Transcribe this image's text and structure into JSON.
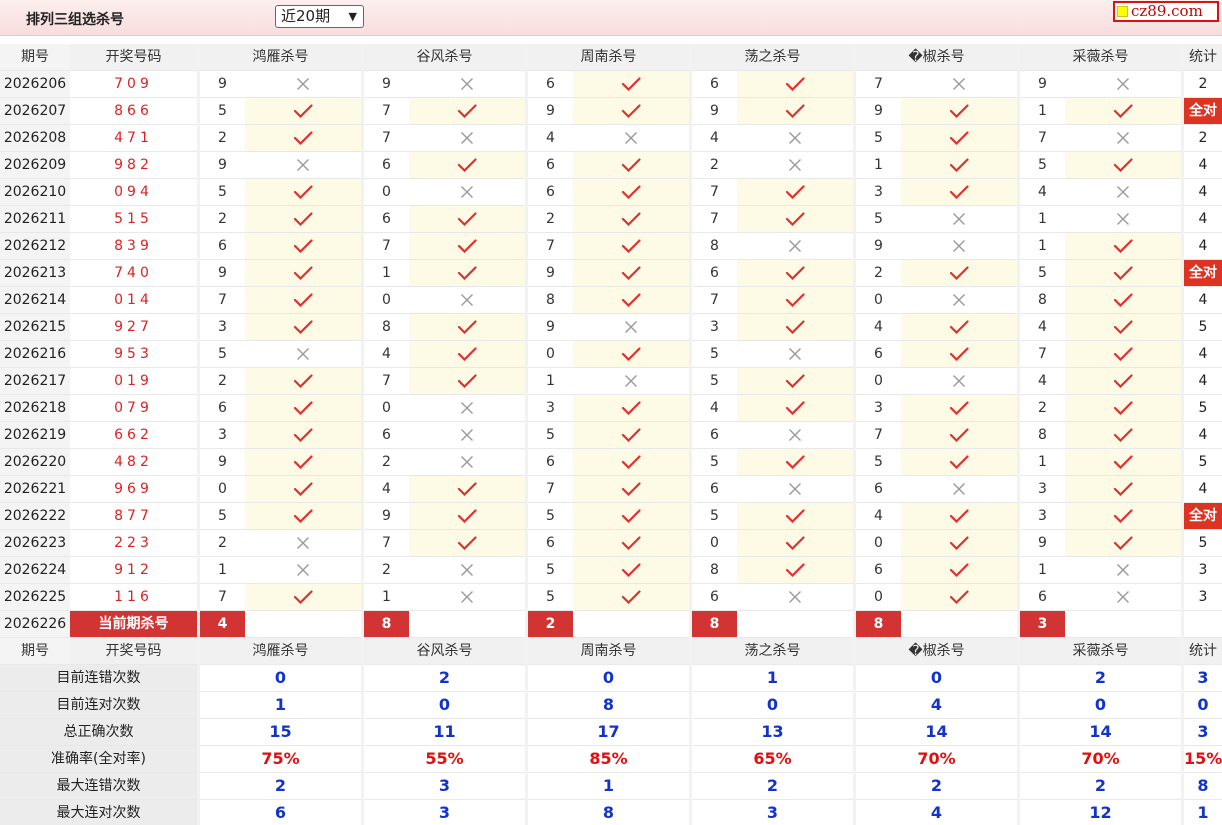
{
  "header": {
    "title": "排列三组选杀号",
    "period_selected": "近20期",
    "logo_text": "cz89.com"
  },
  "columns": {
    "issue": "期号",
    "draw": "开奖号码",
    "experts": [
      "鸿雁杀号",
      "谷风杀号",
      "周南杀号",
      "荡之杀号",
      "�椒杀号",
      "采薇杀号"
    ],
    "stat": "统计"
  },
  "rows": [
    {
      "issue": "2026206",
      "draw": "709",
      "kills": [
        {
          "n": "9",
          "ok": false
        },
        {
          "n": "9",
          "ok": false
        },
        {
          "n": "6",
          "ok": true
        },
        {
          "n": "6",
          "ok": true
        },
        {
          "n": "7",
          "ok": false
        },
        {
          "n": "9",
          "ok": false
        }
      ],
      "stat": "2"
    },
    {
      "issue": "2026207",
      "draw": "866",
      "kills": [
        {
          "n": "5",
          "ok": true
        },
        {
          "n": "7",
          "ok": true
        },
        {
          "n": "9",
          "ok": true
        },
        {
          "n": "9",
          "ok": true
        },
        {
          "n": "9",
          "ok": true
        },
        {
          "n": "1",
          "ok": true
        }
      ],
      "stat": "全对"
    },
    {
      "issue": "2026208",
      "draw": "471",
      "kills": [
        {
          "n": "2",
          "ok": true
        },
        {
          "n": "7",
          "ok": false
        },
        {
          "n": "4",
          "ok": false
        },
        {
          "n": "4",
          "ok": false
        },
        {
          "n": "5",
          "ok": true
        },
        {
          "n": "7",
          "ok": false
        }
      ],
      "stat": "2"
    },
    {
      "issue": "2026209",
      "draw": "982",
      "kills": [
        {
          "n": "9",
          "ok": false
        },
        {
          "n": "6",
          "ok": true
        },
        {
          "n": "6",
          "ok": true
        },
        {
          "n": "2",
          "ok": false
        },
        {
          "n": "1",
          "ok": true
        },
        {
          "n": "5",
          "ok": true
        }
      ],
      "stat": "4"
    },
    {
      "issue": "2026210",
      "draw": "094",
      "kills": [
        {
          "n": "5",
          "ok": true
        },
        {
          "n": "0",
          "ok": false
        },
        {
          "n": "6",
          "ok": true
        },
        {
          "n": "7",
          "ok": true
        },
        {
          "n": "3",
          "ok": true
        },
        {
          "n": "4",
          "ok": false
        }
      ],
      "stat": "4"
    },
    {
      "issue": "2026211",
      "draw": "515",
      "kills": [
        {
          "n": "2",
          "ok": true
        },
        {
          "n": "6",
          "ok": true
        },
        {
          "n": "2",
          "ok": true
        },
        {
          "n": "7",
          "ok": true
        },
        {
          "n": "5",
          "ok": false
        },
        {
          "n": "1",
          "ok": false
        }
      ],
      "stat": "4"
    },
    {
      "issue": "2026212",
      "draw": "839",
      "kills": [
        {
          "n": "6",
          "ok": true
        },
        {
          "n": "7",
          "ok": true
        },
        {
          "n": "7",
          "ok": true
        },
        {
          "n": "8",
          "ok": false
        },
        {
          "n": "9",
          "ok": false
        },
        {
          "n": "1",
          "ok": true
        }
      ],
      "stat": "4"
    },
    {
      "issue": "2026213",
      "draw": "740",
      "kills": [
        {
          "n": "9",
          "ok": true
        },
        {
          "n": "1",
          "ok": true
        },
        {
          "n": "9",
          "ok": true
        },
        {
          "n": "6",
          "ok": true
        },
        {
          "n": "2",
          "ok": true
        },
        {
          "n": "5",
          "ok": true
        }
      ],
      "stat": "全对"
    },
    {
      "issue": "2026214",
      "draw": "014",
      "kills": [
        {
          "n": "7",
          "ok": true
        },
        {
          "n": "0",
          "ok": false
        },
        {
          "n": "8",
          "ok": true
        },
        {
          "n": "7",
          "ok": true
        },
        {
          "n": "0",
          "ok": false
        },
        {
          "n": "8",
          "ok": true
        }
      ],
      "stat": "4"
    },
    {
      "issue": "2026215",
      "draw": "927",
      "kills": [
        {
          "n": "3",
          "ok": true
        },
        {
          "n": "8",
          "ok": true
        },
        {
          "n": "9",
          "ok": false
        },
        {
          "n": "3",
          "ok": true
        },
        {
          "n": "4",
          "ok": true
        },
        {
          "n": "4",
          "ok": true
        }
      ],
      "stat": "5"
    },
    {
      "issue": "2026216",
      "draw": "953",
      "kills": [
        {
          "n": "5",
          "ok": false
        },
        {
          "n": "4",
          "ok": true
        },
        {
          "n": "0",
          "ok": true
        },
        {
          "n": "5",
          "ok": false
        },
        {
          "n": "6",
          "ok": true
        },
        {
          "n": "7",
          "ok": true
        }
      ],
      "stat": "4"
    },
    {
      "issue": "2026217",
      "draw": "019",
      "kills": [
        {
          "n": "2",
          "ok": true
        },
        {
          "n": "7",
          "ok": true
        },
        {
          "n": "1",
          "ok": false
        },
        {
          "n": "5",
          "ok": true
        },
        {
          "n": "0",
          "ok": false
        },
        {
          "n": "4",
          "ok": true
        }
      ],
      "stat": "4"
    },
    {
      "issue": "2026218",
      "draw": "079",
      "kills": [
        {
          "n": "6",
          "ok": true
        },
        {
          "n": "0",
          "ok": false
        },
        {
          "n": "3",
          "ok": true
        },
        {
          "n": "4",
          "ok": true
        },
        {
          "n": "3",
          "ok": true
        },
        {
          "n": "2",
          "ok": true
        }
      ],
      "stat": "5"
    },
    {
      "issue": "2026219",
      "draw": "662",
      "kills": [
        {
          "n": "3",
          "ok": true
        },
        {
          "n": "6",
          "ok": false
        },
        {
          "n": "5",
          "ok": true
        },
        {
          "n": "6",
          "ok": false
        },
        {
          "n": "7",
          "ok": true
        },
        {
          "n": "8",
          "ok": true
        }
      ],
      "stat": "4"
    },
    {
      "issue": "2026220",
      "draw": "482",
      "kills": [
        {
          "n": "9",
          "ok": true
        },
        {
          "n": "2",
          "ok": false
        },
        {
          "n": "6",
          "ok": true
        },
        {
          "n": "5",
          "ok": true
        },
        {
          "n": "5",
          "ok": true
        },
        {
          "n": "1",
          "ok": true
        }
      ],
      "stat": "5"
    },
    {
      "issue": "2026221",
      "draw": "969",
      "kills": [
        {
          "n": "0",
          "ok": true
        },
        {
          "n": "4",
          "ok": true
        },
        {
          "n": "7",
          "ok": true
        },
        {
          "n": "6",
          "ok": false
        },
        {
          "n": "6",
          "ok": false
        },
        {
          "n": "3",
          "ok": true
        }
      ],
      "stat": "4"
    },
    {
      "issue": "2026222",
      "draw": "877",
      "kills": [
        {
          "n": "5",
          "ok": true
        },
        {
          "n": "9",
          "ok": true
        },
        {
          "n": "5",
          "ok": true
        },
        {
          "n": "5",
          "ok": true
        },
        {
          "n": "4",
          "ok": true
        },
        {
          "n": "3",
          "ok": true
        }
      ],
      "stat": "全对"
    },
    {
      "issue": "2026223",
      "draw": "223",
      "kills": [
        {
          "n": "2",
          "ok": false
        },
        {
          "n": "7",
          "ok": true
        },
        {
          "n": "6",
          "ok": true
        },
        {
          "n": "0",
          "ok": true
        },
        {
          "n": "0",
          "ok": true
        },
        {
          "n": "9",
          "ok": true
        }
      ],
      "stat": "5"
    },
    {
      "issue": "2026224",
      "draw": "912",
      "kills": [
        {
          "n": "1",
          "ok": false
        },
        {
          "n": "2",
          "ok": false
        },
        {
          "n": "5",
          "ok": true
        },
        {
          "n": "8",
          "ok": true
        },
        {
          "n": "6",
          "ok": true
        },
        {
          "n": "1",
          "ok": false
        }
      ],
      "stat": "3"
    },
    {
      "issue": "2026225",
      "draw": "116",
      "kills": [
        {
          "n": "7",
          "ok": true
        },
        {
          "n": "1",
          "ok": false
        },
        {
          "n": "5",
          "ok": true
        },
        {
          "n": "6",
          "ok": false
        },
        {
          "n": "0",
          "ok": true
        },
        {
          "n": "6",
          "ok": false
        }
      ],
      "stat": "3"
    }
  ],
  "current": {
    "issue": "2026226",
    "label": "当前期杀号",
    "kills": [
      "4",
      "8",
      "2",
      "8",
      "8",
      "3"
    ]
  },
  "summary": {
    "issue": "期号",
    "draw": "开奖号码",
    "rows": [
      {
        "label": "目前连错次数",
        "values": [
          "0",
          "2",
          "0",
          "1",
          "0",
          "2"
        ],
        "stat": "3"
      },
      {
        "label": "目前连对次数",
        "values": [
          "1",
          "0",
          "8",
          "0",
          "4",
          "0"
        ],
        "stat": "0"
      },
      {
        "label": "总正确次数",
        "values": [
          "15",
          "11",
          "17",
          "13",
          "14",
          "14"
        ],
        "stat": "3"
      },
      {
        "label": "准确率(全对率)",
        "values": [
          "75%",
          "55%",
          "85%",
          "65%",
          "70%",
          "70%"
        ],
        "stat": "15%",
        "red": true
      },
      {
        "label": "最大连错次数",
        "values": [
          "2",
          "3",
          "1",
          "2",
          "2",
          "2"
        ],
        "stat": "8"
      },
      {
        "label": "最大连对次数",
        "values": [
          "6",
          "3",
          "8",
          "3",
          "4",
          "12"
        ],
        "stat": "1"
      }
    ]
  },
  "colors": {
    "accent_red": "#d23333",
    "check_red": "#e03030",
    "cross_grey": "#999999",
    "value_blue": "#1133cc"
  }
}
